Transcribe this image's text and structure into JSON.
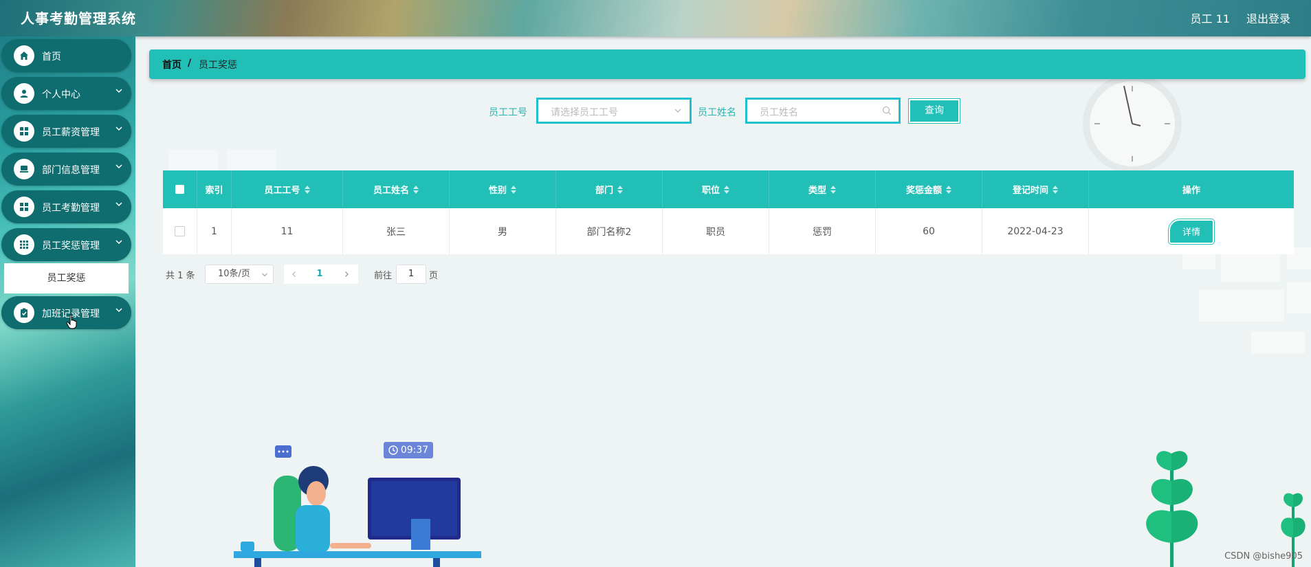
{
  "header": {
    "title": "人事考勤管理系统",
    "user": "员工 11",
    "logout": "退出登录"
  },
  "sidebar": {
    "items": [
      {
        "label": "首页",
        "icon": "home-icon",
        "has_children": false
      },
      {
        "label": "个人中心",
        "icon": "user-icon",
        "has_children": true
      },
      {
        "label": "员工薪资管理",
        "icon": "grid-icon",
        "has_children": true
      },
      {
        "label": "部门信息管理",
        "icon": "monitor-icon",
        "has_children": true
      },
      {
        "label": "员工考勤管理",
        "icon": "grid-icon",
        "has_children": true
      },
      {
        "label": "员工奖惩管理",
        "icon": "apps-icon",
        "has_children": true
      },
      {
        "label": "加班记录管理",
        "icon": "clipboard-icon",
        "has_children": true
      }
    ],
    "submenu": {
      "label": "员工奖惩"
    }
  },
  "breadcrumb": {
    "home": "首页",
    "separator": "/",
    "current": "员工奖惩"
  },
  "search": {
    "emp_id_label": "员工工号",
    "emp_id_placeholder": "请选择员工工号",
    "emp_name_label": "员工姓名",
    "emp_name_placeholder": "员工姓名",
    "button": "查询"
  },
  "table": {
    "headers": [
      "索引",
      "员工工号",
      "员工姓名",
      "性别",
      "部门",
      "职位",
      "类型",
      "奖惩金额",
      "登记时间",
      "操作"
    ],
    "rows": [
      {
        "index": "1",
        "emp_id": "11",
        "name": "张三",
        "gender": "男",
        "dept": "部门名称2",
        "position": "职员",
        "type": "惩罚",
        "amount": "60",
        "date": "2022-04-23",
        "action": "详情"
      }
    ]
  },
  "pagination": {
    "total": "共 1 条",
    "page_size": "10条/页",
    "current": "1",
    "goto": "前往",
    "goto_value": "1",
    "unit": "页"
  },
  "illustration": {
    "clock_text": "09:37"
  },
  "watermark": "CSDN @bishe905",
  "colors": {
    "accent": "#22bfb7",
    "sidebar_item": "#106d6f"
  }
}
